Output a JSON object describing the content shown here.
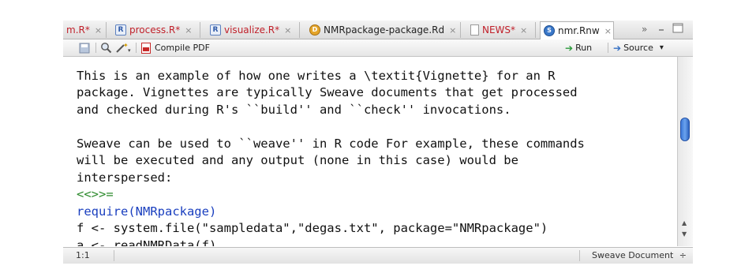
{
  "tabs": [
    {
      "label": "m.R*",
      "close": "×",
      "modified": true
    },
    {
      "label": "process.R*",
      "close": "×",
      "modified": true
    },
    {
      "label": "visualize.R*",
      "close": "×",
      "modified": true
    },
    {
      "label": "NMRpackage-package.Rd",
      "close": "×",
      "modified": false
    },
    {
      "label": "NEWS*",
      "close": "×",
      "modified": true
    },
    {
      "label": "nmr.Rnw",
      "close": "×",
      "modified": false,
      "active": true
    }
  ],
  "tab_overflow": "»",
  "toolbar": {
    "compile_label": "Compile PDF",
    "run_label": "Run",
    "source_label": "Source",
    "source_menu": "▾"
  },
  "editor_lines": [
    "This is an example of how one writes a \\textit{Vignette} for an R",
    "package. Vignettes are typically Sweave documents that get processed",
    "and checked during R's ``build'' and ``check'' invocations.",
    "",
    "Sweave can be used to ``weave'' in R code For example, these commands",
    "will be executed and any output (none in this case) would be",
    "interspersed:",
    "<<>>=",
    "require(NMRpackage)",
    "f <- system.file(\"sampledata\",\"degas.txt\", package=\"NMRpackage\")",
    "a <- readNMRData(f)"
  ],
  "statusbar": {
    "cursor_position": "1:1",
    "document_type": "Sweave Document",
    "doc_type_arrows": "÷"
  },
  "colors": {
    "modified_tab": "#c0202a",
    "string": "#2e8b2e",
    "keyword": "#1a3fbf",
    "scroll_thumb": "#3c78d8"
  }
}
